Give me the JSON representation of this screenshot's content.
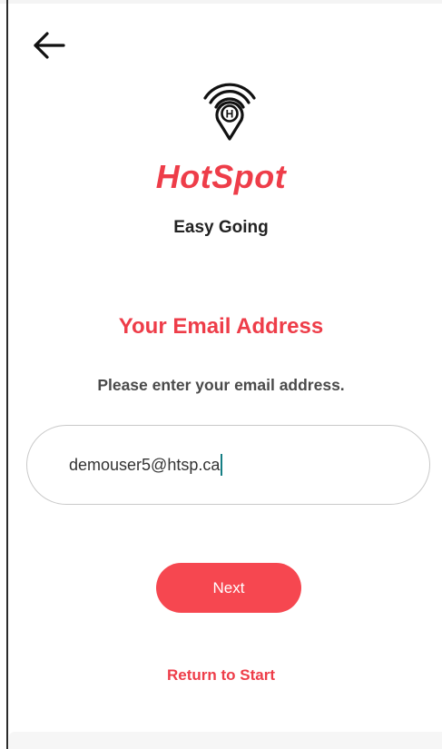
{
  "brand": {
    "name": "HotSpot",
    "tagline": "Easy Going",
    "logo_letter": "H",
    "accent_color": "#ee3d49"
  },
  "nav": {
    "back_icon": "arrow-left-icon"
  },
  "form": {
    "title": "Your Email Address",
    "instructions": "Please enter your email address.",
    "email_value": "demouser5@htsp.ca",
    "caret_color": "#157e84"
  },
  "actions": {
    "next_label": "Next",
    "next_color": "#f64750",
    "return_label": "Return to Start"
  }
}
